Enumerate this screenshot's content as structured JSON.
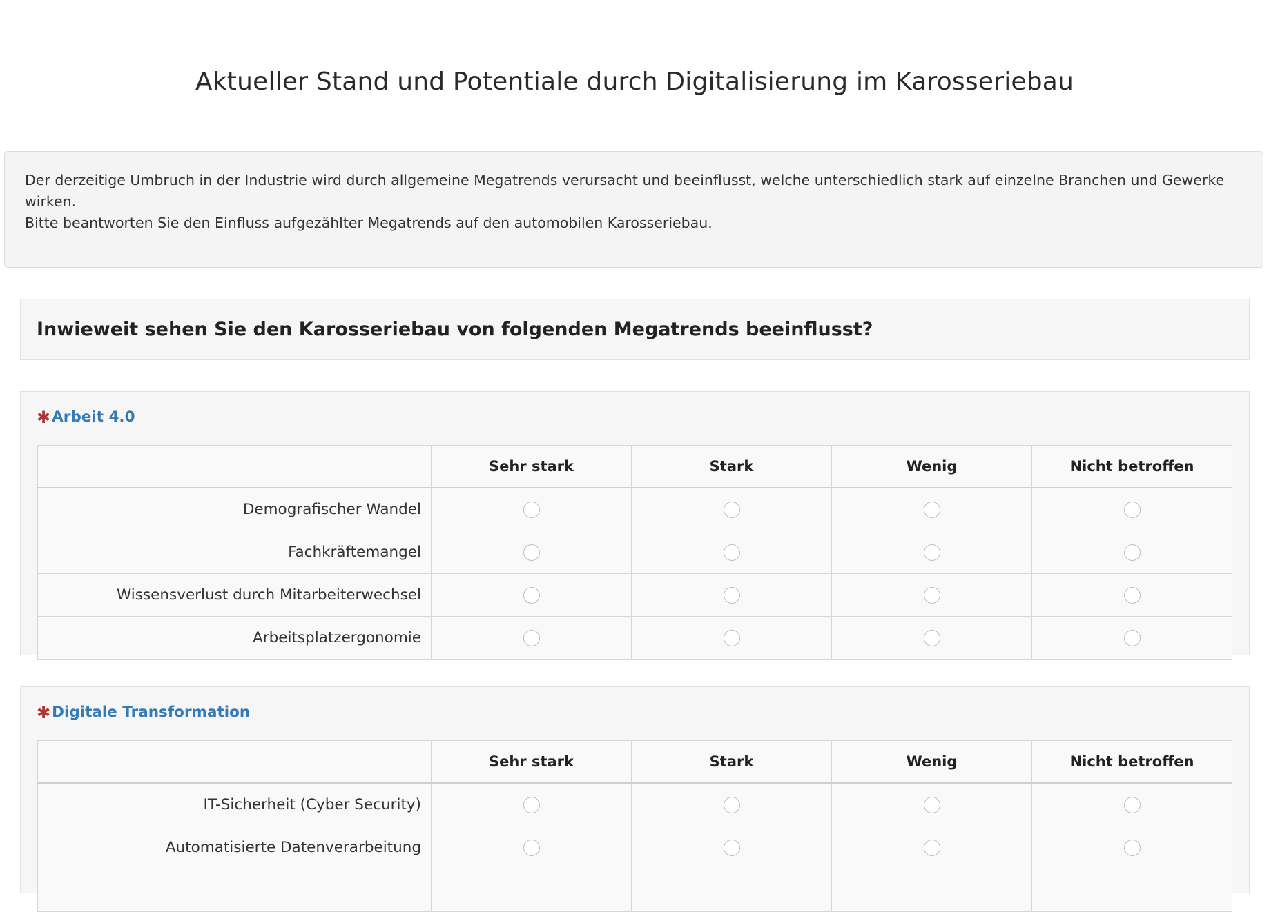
{
  "page": {
    "title": "Aktueller Stand und Potentiale durch Digitalisierung im Karosseriebau"
  },
  "intro": {
    "line1": "Der derzeitige Umbruch in der Industrie wird durch allgemeine Megatrends verursacht und beeinflusst, welche unterschiedlich stark auf einzelne Branchen und Gewerke wirken.",
    "line2": "Bitte beantworten Sie den Einfluss aufgezählter Megatrends auf den automobilen Karosseriebau."
  },
  "question": {
    "text": "Inwieweit sehen Sie den Karosseriebau von folgenden Megatrends beeinflusst?"
  },
  "required_marker": "✱",
  "options": [
    "Sehr stark",
    "Stark",
    "Wenig",
    "Nicht betroffen"
  ],
  "groups": [
    {
      "title": "Arbeit 4.0",
      "rows": [
        "Demografischer Wandel",
        "Fachkräftemangel",
        "Wissensverlust durch Mitarbeiterwechsel",
        "Arbeitsplatzergonomie"
      ]
    },
    {
      "title": "Digitale Transformation",
      "rows": [
        "IT-Sicherheit (Cyber Security)",
        "Automatisierte Datenverarbeitung",
        ""
      ]
    }
  ],
  "colors": {
    "heading_blue": "#337ab7",
    "required_red": "#b03434",
    "panel_bg": "#f6f6f6"
  }
}
